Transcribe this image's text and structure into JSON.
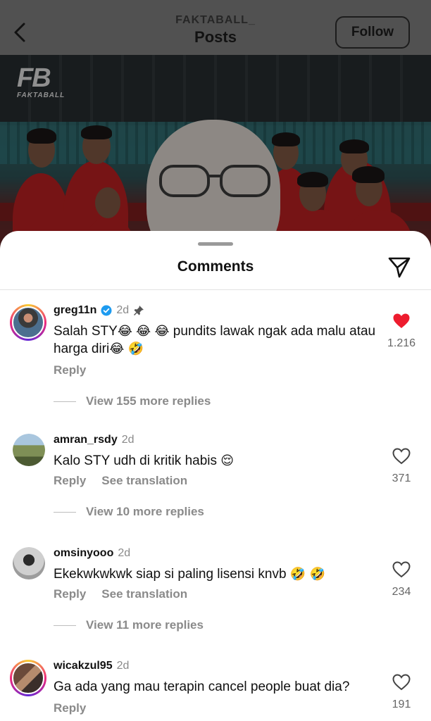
{
  "header": {
    "account": "FAKTABALL_",
    "title": "Posts",
    "follow_label": "Follow"
  },
  "post": {
    "logo_big": "FB",
    "logo_small": "FAKTABALL"
  },
  "comments_sheet": {
    "title": "Comments"
  },
  "comments": [
    {
      "username": "greg11n",
      "verified": true,
      "pinned": true,
      "time": "2d",
      "text_parts": [
        "Salah STY",
        "😂",
        "😂",
        "😂",
        " pundits lawak ngak ada malu atau harga diri",
        "😂",
        "🤣"
      ],
      "liked": true,
      "likes": "1.216",
      "actions": [
        "Reply"
      ],
      "view_replies": "View 155 more replies"
    },
    {
      "username": "amran_rsdy",
      "time": "2d",
      "text_parts": [
        "Kalo STY udh di kritik habis ",
        "😌"
      ],
      "liked": false,
      "likes": "371",
      "actions": [
        "Reply",
        "See translation"
      ],
      "view_replies": "View 10 more replies"
    },
    {
      "username": "omsinyooo",
      "time": "2d",
      "text_parts": [
        "Ekekwkwkwk siap si paling lisensi knvb ",
        "🤣",
        " ",
        "🤣"
      ],
      "liked": false,
      "likes": "234",
      "actions": [
        "Reply",
        "See translation"
      ],
      "view_replies": "View 11 more replies"
    },
    {
      "username": "wicakzul95",
      "time": "2d",
      "text_parts": [
        "Ga ada yang mau terapin cancel people buat dia?"
      ],
      "liked": false,
      "likes": "191",
      "actions": [
        "Reply"
      ]
    }
  ],
  "icons": {
    "back": "chevron-left-icon",
    "share": "send-icon",
    "verified": "verified-badge-icon",
    "pin": "pin-icon",
    "like": "heart-icon"
  },
  "colors": {
    "like_active": "#ed1c2e",
    "verified": "#1d9bf0"
  }
}
